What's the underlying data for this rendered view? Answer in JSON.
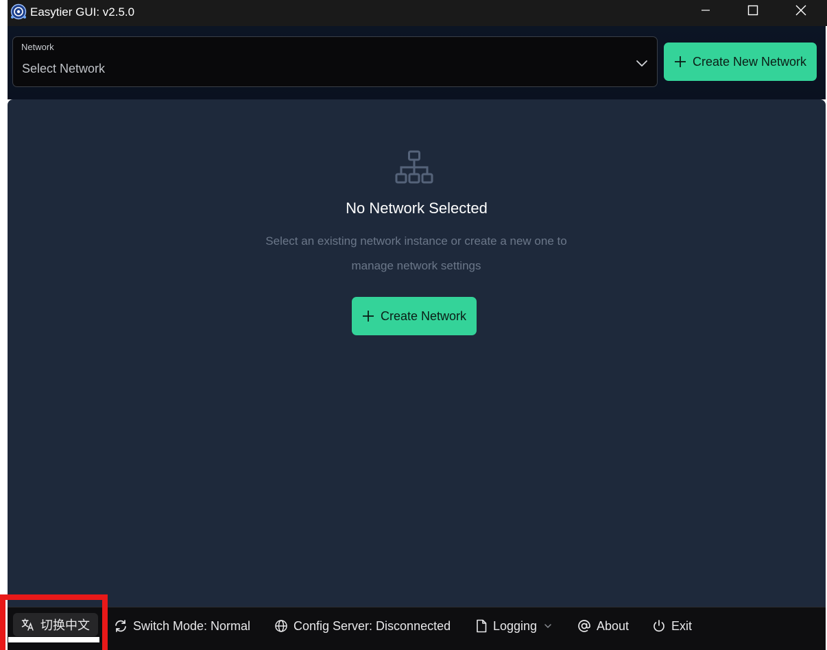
{
  "window": {
    "title": "Easytier GUI: v2.5.0"
  },
  "header": {
    "network_label": "Network",
    "network_placeholder": "Select Network",
    "create_new_label": "Create New Network"
  },
  "main": {
    "empty_title": "No Network Selected",
    "empty_desc": "Select an existing network instance or create a new one to manage network settings",
    "create_label": "Create Network"
  },
  "footer": {
    "language": "切换中文",
    "mode": "Switch Mode: Normal",
    "config": "Config Server: Disconnected",
    "logging": "Logging",
    "about": "About",
    "exit": "Exit"
  },
  "colors": {
    "accent": "#34d399",
    "panel": "#1e293b",
    "highlight": "#e81919"
  },
  "icons": {
    "app": "easytier-logo-icon",
    "minimize": "minimize-icon",
    "maximize": "maximize-icon",
    "close": "close-icon",
    "chevron": "chevron-down-icon",
    "plus": "plus-icon",
    "network": "network-tree-icon",
    "language": "translate-icon",
    "mode": "sync-icon",
    "config": "globe-icon",
    "logging": "file-icon",
    "about": "at-sign-icon",
    "exit": "power-icon"
  }
}
